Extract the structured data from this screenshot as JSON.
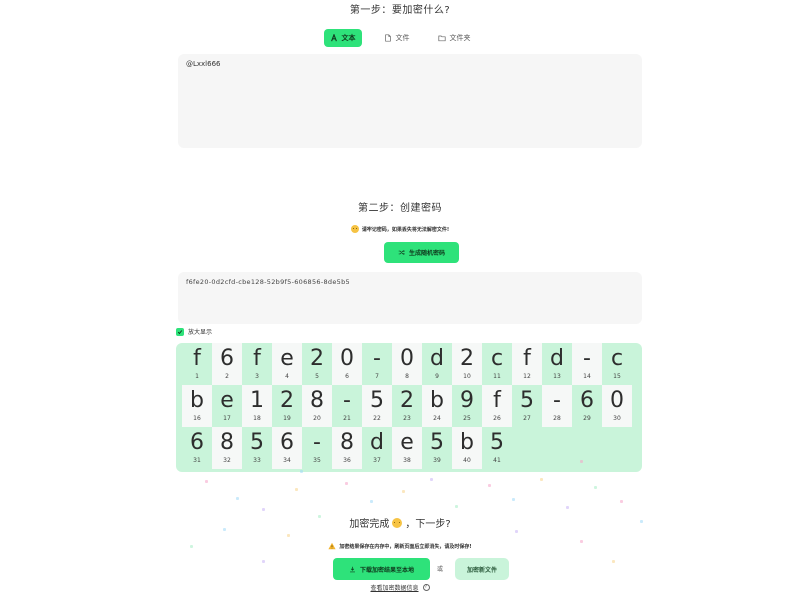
{
  "step1": {
    "title": "第一步：要加密什么?",
    "tabs": [
      {
        "label": "文本",
        "icon": "text-icon",
        "active": true
      },
      {
        "label": "文件",
        "icon": "file-icon",
        "active": false
      },
      {
        "label": "文件夹",
        "icon": "folder-icon",
        "active": false
      }
    ],
    "text_value": "@Lxxl666"
  },
  "step2": {
    "title": "第二步：创建密码",
    "warning": "请牢记密码，如果丢失将无法解密文件!",
    "generate_button": "生成随机密码",
    "password": "f6fe20-0d2cfd-cbe128-52b9f5-606856-8de5b5",
    "enlarge_label": "放大显示",
    "enlarge_checked": true,
    "characters": [
      {
        "ch": "f",
        "n": "1"
      },
      {
        "ch": "6",
        "n": "2"
      },
      {
        "ch": "f",
        "n": "3"
      },
      {
        "ch": "e",
        "n": "4"
      },
      {
        "ch": "2",
        "n": "5"
      },
      {
        "ch": "0",
        "n": "6"
      },
      {
        "ch": "-",
        "n": "7"
      },
      {
        "ch": "0",
        "n": "8"
      },
      {
        "ch": "d",
        "n": "9"
      },
      {
        "ch": "2",
        "n": "10"
      },
      {
        "ch": "c",
        "n": "11"
      },
      {
        "ch": "f",
        "n": "12"
      },
      {
        "ch": "d",
        "n": "13"
      },
      {
        "ch": "-",
        "n": "14"
      },
      {
        "ch": "c",
        "n": "15"
      },
      {
        "ch": "b",
        "n": "16"
      },
      {
        "ch": "e",
        "n": "17"
      },
      {
        "ch": "1",
        "n": "18"
      },
      {
        "ch": "2",
        "n": "19"
      },
      {
        "ch": "8",
        "n": "20"
      },
      {
        "ch": "-",
        "n": "21"
      },
      {
        "ch": "5",
        "n": "22"
      },
      {
        "ch": "2",
        "n": "23"
      },
      {
        "ch": "b",
        "n": "24"
      },
      {
        "ch": "9",
        "n": "25"
      },
      {
        "ch": "f",
        "n": "26"
      },
      {
        "ch": "5",
        "n": "27"
      },
      {
        "ch": "-",
        "n": "28"
      },
      {
        "ch": "6",
        "n": "29"
      },
      {
        "ch": "0",
        "n": "30"
      },
      {
        "ch": "6",
        "n": "31"
      },
      {
        "ch": "8",
        "n": "32"
      },
      {
        "ch": "5",
        "n": "33"
      },
      {
        "ch": "6",
        "n": "34"
      },
      {
        "ch": "-",
        "n": "35"
      },
      {
        "ch": "8",
        "n": "36"
      },
      {
        "ch": "d",
        "n": "37"
      },
      {
        "ch": "e",
        "n": "38"
      },
      {
        "ch": "5",
        "n": "39"
      },
      {
        "ch": "b",
        "n": "40"
      },
      {
        "ch": "5",
        "n": "41"
      }
    ]
  },
  "step3": {
    "title": "加密完成",
    "title_suffix": "，下一步?",
    "warning": "加密结果保存在内存中，刷新页面后立即消失，请及时保存!",
    "download_button": "下载加密结果至本地",
    "or_text": "或",
    "encrypt_file_button": "加密新文件",
    "link_text": "查看加密数据信息",
    "help_icon": "?"
  },
  "colors": {
    "accent": "#2ee27a",
    "accent_light": "#c9f4da",
    "panel_bg": "#f6f6f6"
  }
}
